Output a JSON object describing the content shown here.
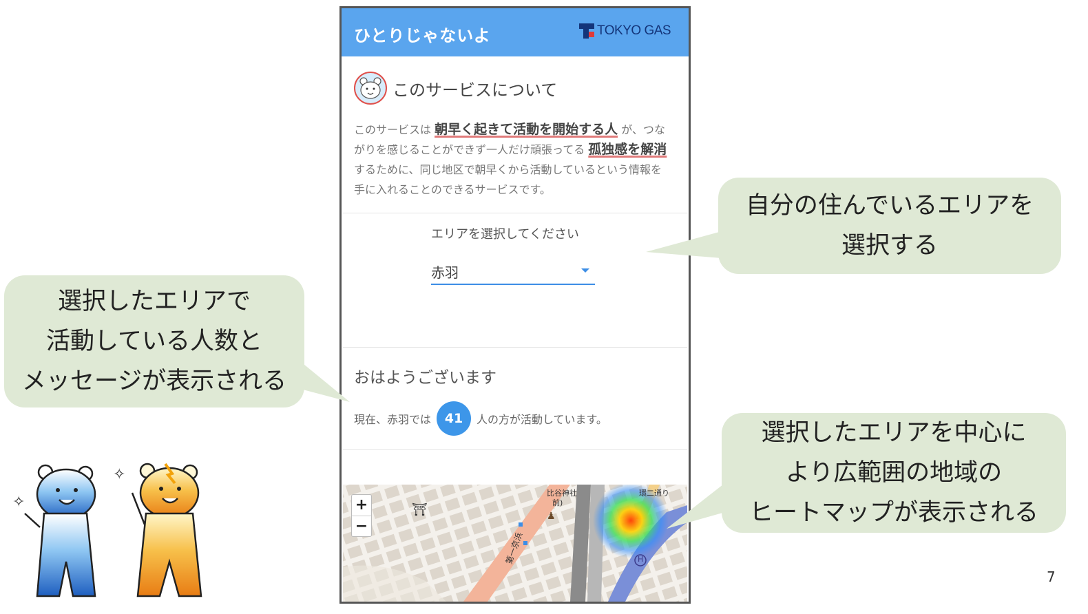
{
  "app": {
    "title": "ひとりじゃないよ",
    "logo_text": "TOKYO GAS"
  },
  "about": {
    "title": "このサービスについて",
    "text_1": "このサービスは ",
    "highlight_1": "朝早く起きて活動を開始する人",
    "text_2": " が、つながりを感じることができず一人だけ頑張ってる ",
    "highlight_2": "孤独感を解消",
    "text_3": " するために、同じ地区で朝早くから活動しているという情報を手に入れることのできるサービスです。"
  },
  "area_select": {
    "label": "エリアを選択してください",
    "value": "赤羽"
  },
  "greeting": {
    "title": "おはようございます",
    "status_prefix": "現在、赤羽では",
    "count": "41",
    "status_suffix": "人の方が活動しています。"
  },
  "map": {
    "zoom_in": "+",
    "zoom_out": "−",
    "label_shrine": "比谷神社",
    "label_shrine_2": "前)",
    "label_street": "第一京浜",
    "label_road": "環二通り",
    "label_hospital": "H"
  },
  "callouts": {
    "area": [
      "自分の住んでいるエリアを",
      "選択する"
    ],
    "count": [
      "選択したエリアで",
      "活動している人数と",
      "メッセージが表示される"
    ],
    "heatmap": [
      "選択したエリアを中心に",
      "より広範囲の地域の",
      "ヒートマップが表示される"
    ]
  },
  "page_number": "7",
  "colors": {
    "appbar": "#5aa5ee",
    "accent": "#3d96e9",
    "callout_bg": "#dfe9d5",
    "highlight_underline": "#e07a7a"
  }
}
